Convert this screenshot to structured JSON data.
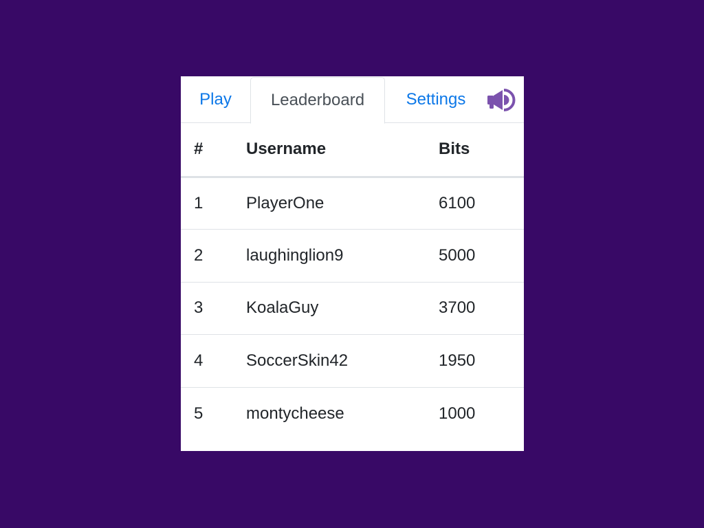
{
  "tabs": {
    "play": "Play",
    "leaderboard": "Leaderboard",
    "settings": "Settings",
    "sound_icon": "megaphone-icon"
  },
  "colors": {
    "background": "#380966",
    "link": "#0d78e8",
    "active_tab_text": "#495057",
    "icon": "#7b52ad"
  },
  "leaderboard": {
    "headers": {
      "rank": "#",
      "username": "Username",
      "bits": "Bits"
    },
    "rows": [
      {
        "rank": "1",
        "username": "PlayerOne",
        "bits": "6100"
      },
      {
        "rank": "2",
        "username": "laughinglion9",
        "bits": "5000"
      },
      {
        "rank": "3",
        "username": "KoalaGuy",
        "bits": "3700"
      },
      {
        "rank": "4",
        "username": "SoccerSkin42",
        "bits": "1950"
      },
      {
        "rank": "5",
        "username": "montycheese",
        "bits": "1000"
      }
    ]
  }
}
